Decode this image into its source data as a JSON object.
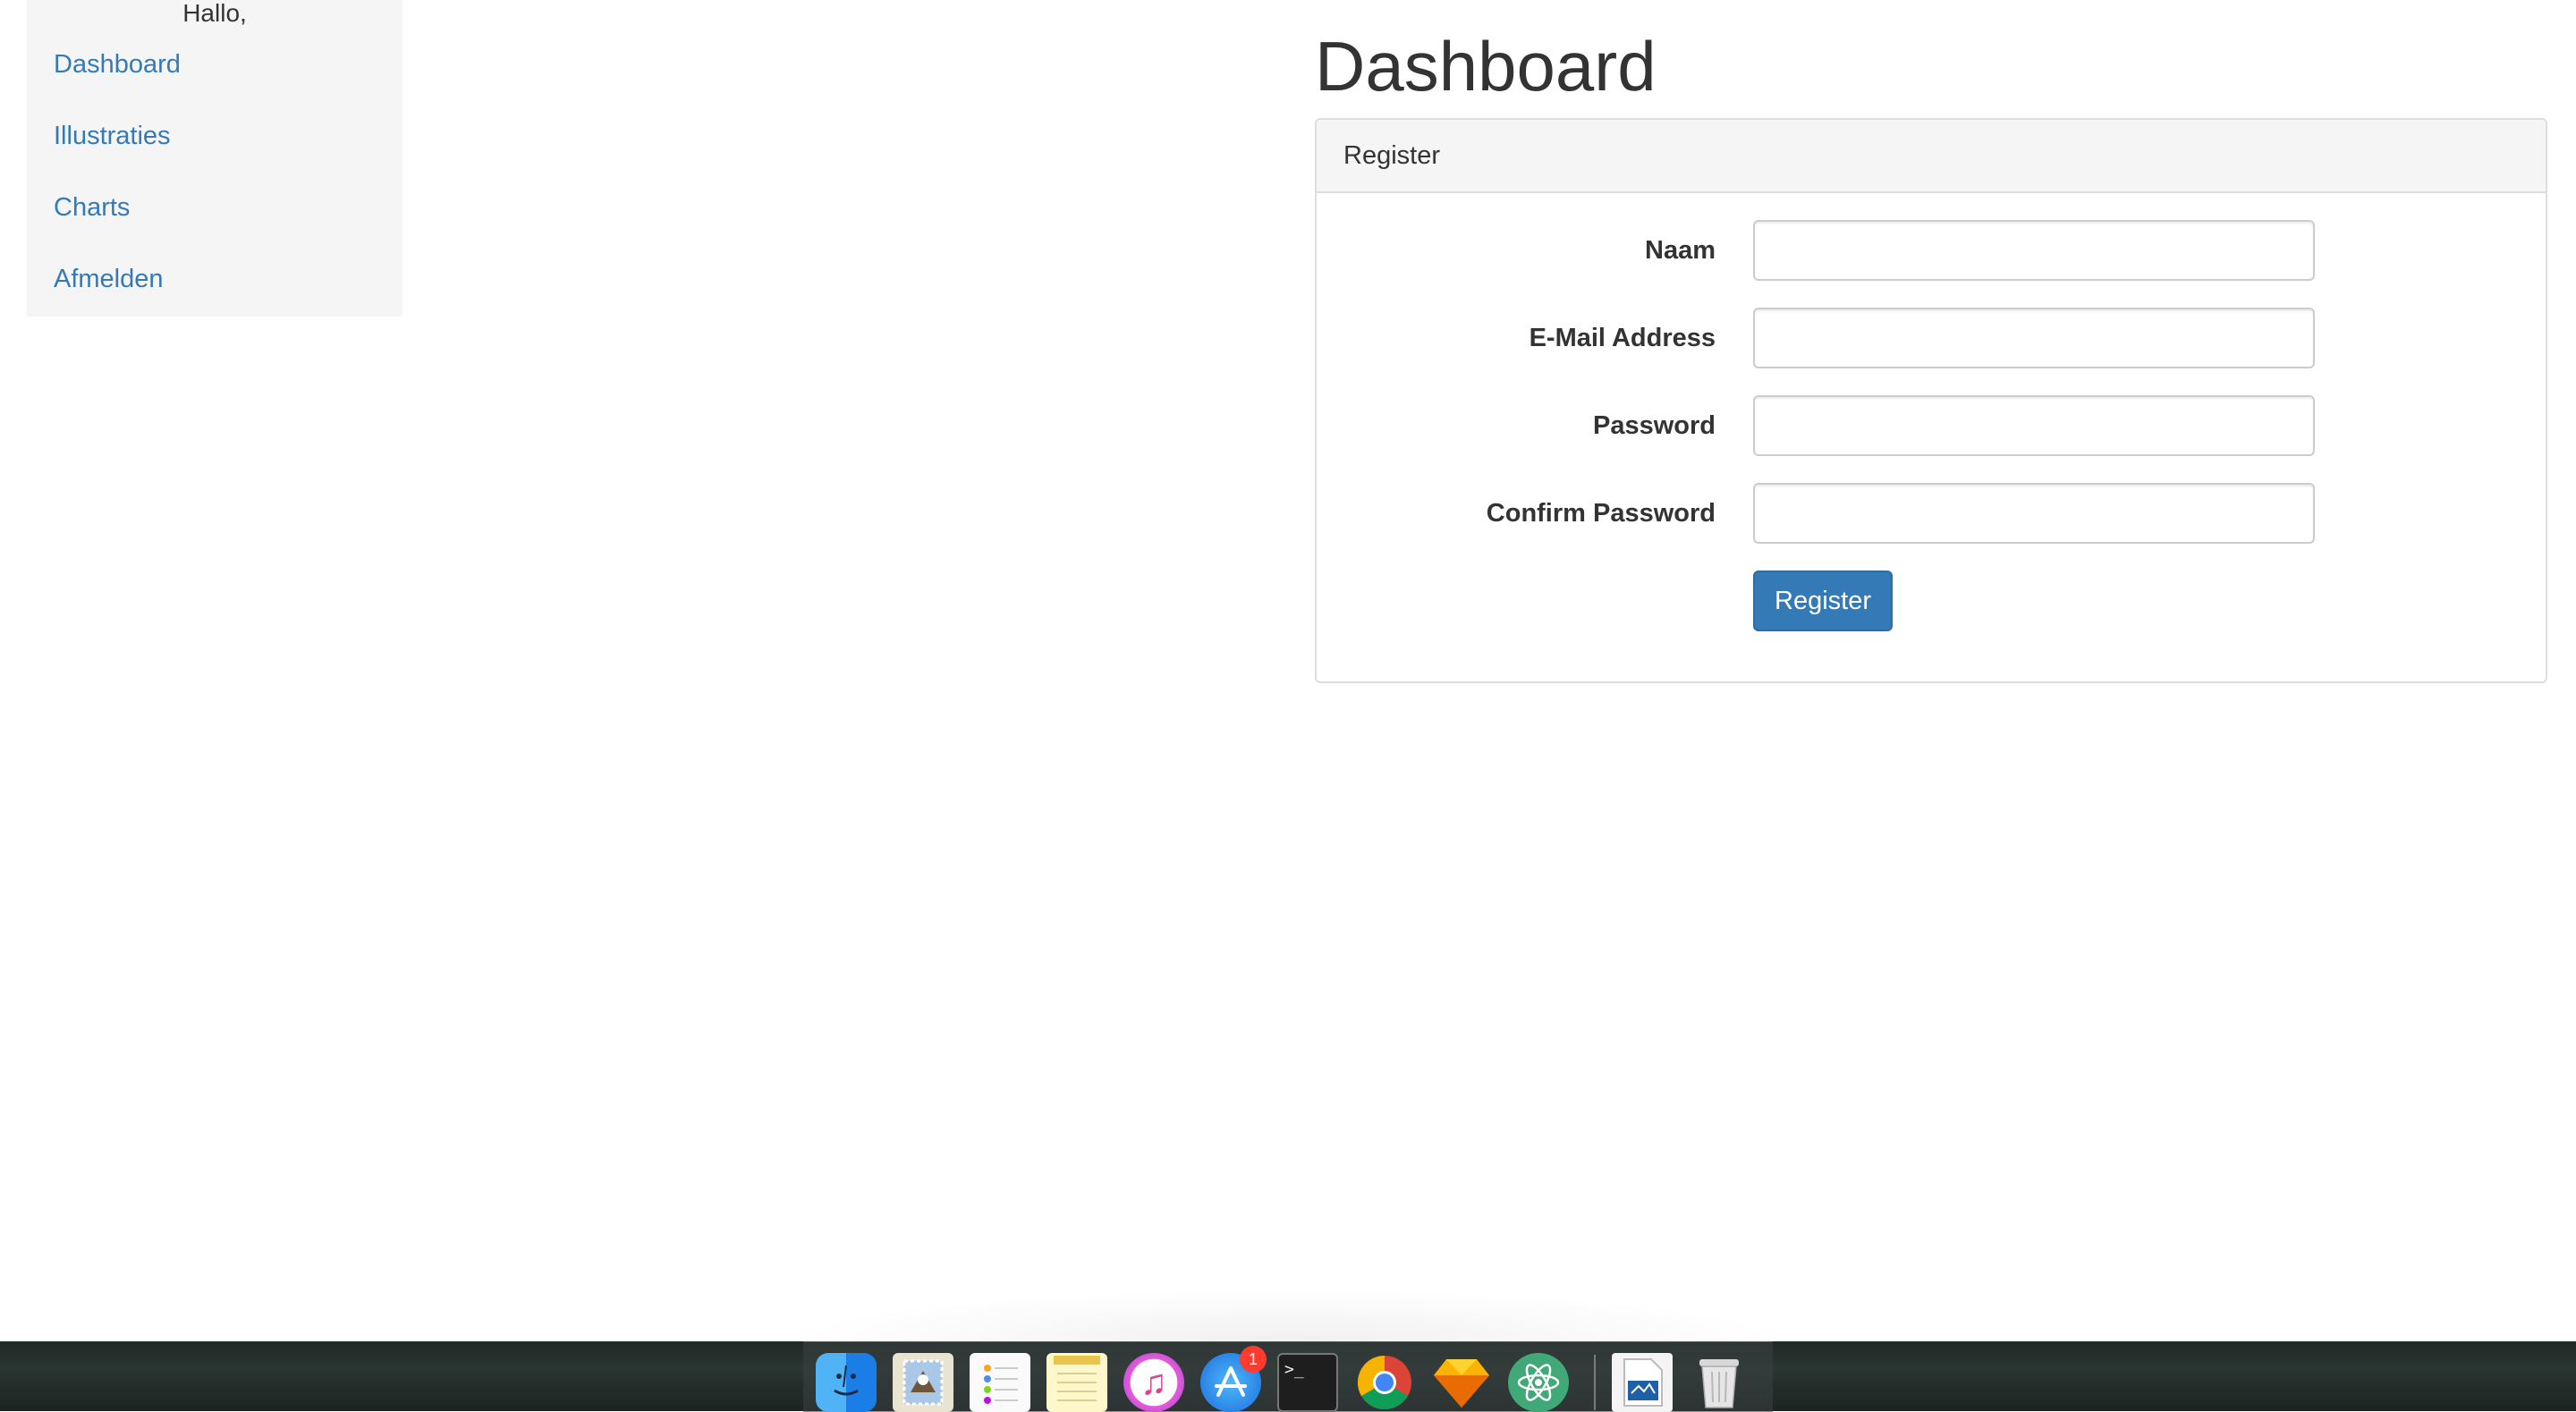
{
  "sidebar": {
    "greeting": "Hallo,",
    "items": [
      {
        "label": "Dashboard"
      },
      {
        "label": "Illustraties"
      },
      {
        "label": "Charts"
      },
      {
        "label": "Afmelden"
      }
    ]
  },
  "main": {
    "title": "Dashboard",
    "panel": {
      "heading": "Register",
      "fields": [
        {
          "label": "Naam",
          "value": ""
        },
        {
          "label": "E-Mail Address",
          "value": ""
        },
        {
          "label": "Password",
          "value": ""
        },
        {
          "label": "Confirm Password",
          "value": ""
        }
      ],
      "submit_label": "Register"
    }
  },
  "dock": {
    "apps": [
      {
        "icon": "finder-icon"
      },
      {
        "icon": "mail-icon"
      },
      {
        "icon": "reminders-icon"
      },
      {
        "icon": "notes-icon"
      },
      {
        "icon": "itunes-icon"
      },
      {
        "icon": "app-store-icon",
        "badge": "1"
      },
      {
        "icon": "terminal-icon"
      },
      {
        "icon": "chrome-icon"
      },
      {
        "icon": "sketch-icon"
      },
      {
        "icon": "atom-icon"
      },
      {
        "icon": "document-icon"
      },
      {
        "icon": "trash-icon"
      }
    ]
  },
  "colors": {
    "link": "#337ab7",
    "primary_button": "#337ab7",
    "sidebar_bg": "#f5f5f5"
  }
}
